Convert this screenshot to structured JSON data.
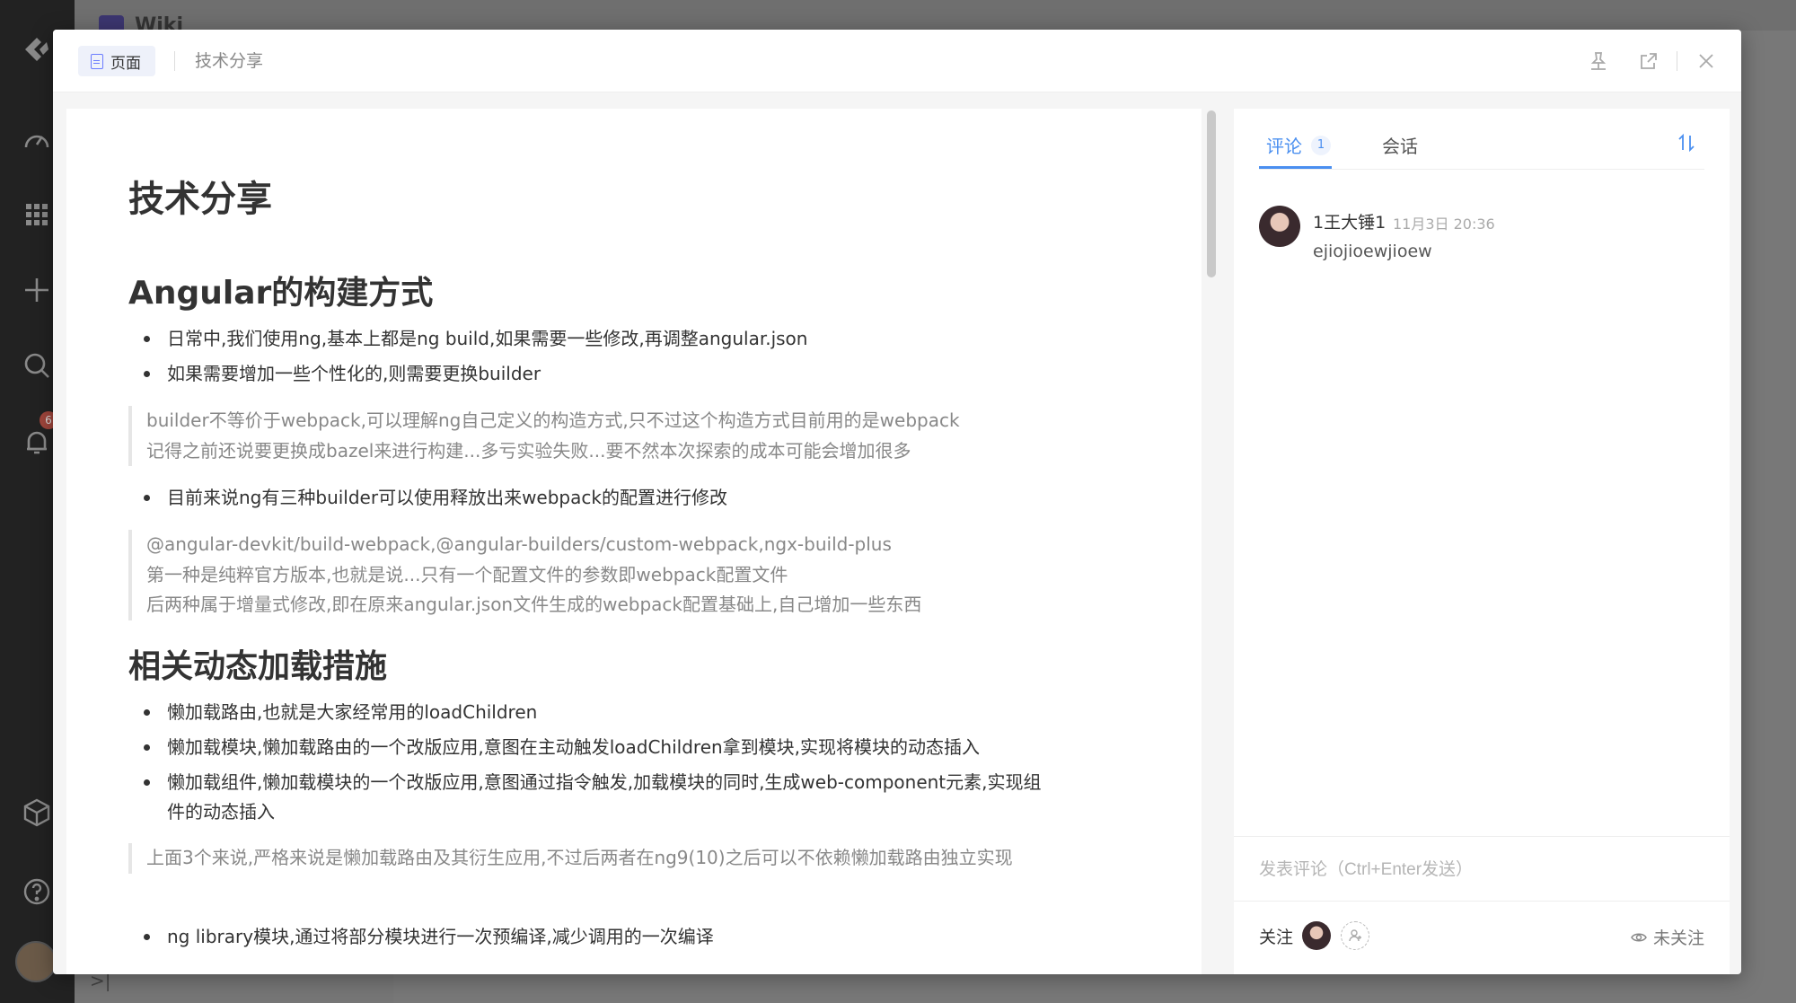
{
  "background": {
    "app_title": "Wiki",
    "notification_count": "6"
  },
  "modal": {
    "page_tag": "页面",
    "title": "技术分享"
  },
  "document": {
    "title": "技术分享",
    "section1_heading": "Angular的构建方式",
    "bullet1": "日常中,我们使用ng,基本上都是ng build,如果需要一些修改,再调整angular.json",
    "bullet2": "如果需要增加一些个性化的,则需要更换builder",
    "quote1": [
      "builder不等价于webpack,可以理解ng自己定义的构造方式,只不过这个构造方式目前用的是webpack",
      "记得之前还说要更换成bazel来进行构建...多亏实验失败...要不然本次探索的成本可能会增加很多"
    ],
    "bullet3": "目前来说ng有三种builder可以使用释放出来webpack的配置进行修改",
    "quote2": [
      "@angular-devkit/build-webpack,@angular-builders/custom-webpack,ngx-build-plus",
      "第一种是纯粹官方版本,也就是说...只有一个配置文件的参数即webpack配置文件",
      "后两种属于增量式修改,即在原来angular.json文件生成的webpack配置基础上,自己增加一些东西"
    ],
    "section2_heading": "相关动态加载措施",
    "bullet4": "懒加载路由,也就是大家经常用的loadChildren",
    "bullet5": "懒加载模块,懒加载路由的一个改版应用,意图在主动触发loadChildren拿到模块,实现将模块的动态插入",
    "bullet6": "懒加载组件,懒加载模块的一个改版应用,意图通过指令触发,加载模块的同时,生成web-component元素,实现组件的动态插入",
    "quote3": "上面3个来说,严格来说是懒加载路由及其衍生应用,不过后两者在ng9(10)之后可以不依赖懒加载路由独立实现",
    "bullet7": "ng library模块,通过将部分模块进行一次预编译,减少调用的一次编译"
  },
  "comments_panel": {
    "tab_comments": "评论",
    "tab_comments_count": "1",
    "tab_chat": "会话",
    "sort_icon": "sort-icon",
    "comment": {
      "author": "1王大锤1",
      "time": "11月3日 20:36",
      "body": "ejiojioewjioew"
    },
    "input_placeholder": "发表评论（Ctrl+Enter发送）",
    "follow_label": "关注",
    "unfollow_label": "未关注"
  }
}
